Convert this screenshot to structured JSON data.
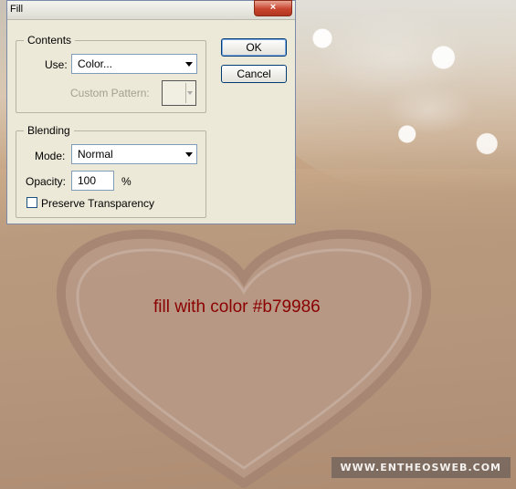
{
  "dialog": {
    "title": "Fill",
    "close_glyph": "×",
    "contents": {
      "legend": "Contents",
      "use_label": "Use:",
      "use_value": "Color...",
      "custom_pattern_label": "Custom Pattern:"
    },
    "blending": {
      "legend": "Blending",
      "mode_label": "Mode:",
      "mode_value": "Normal",
      "opacity_label": "Opacity:",
      "opacity_value": "100",
      "opacity_unit": "%",
      "preserve_transparency_label": "Preserve Transparency",
      "preserve_transparency_checked": false
    },
    "buttons": {
      "ok": "OK",
      "cancel": "Cancel"
    }
  },
  "canvas": {
    "caption": "fill with color #b79986",
    "fill_color": "#b79986",
    "caption_color": "#8b0000",
    "watermark": "WWW.ENTHEOSWEB.COM"
  }
}
